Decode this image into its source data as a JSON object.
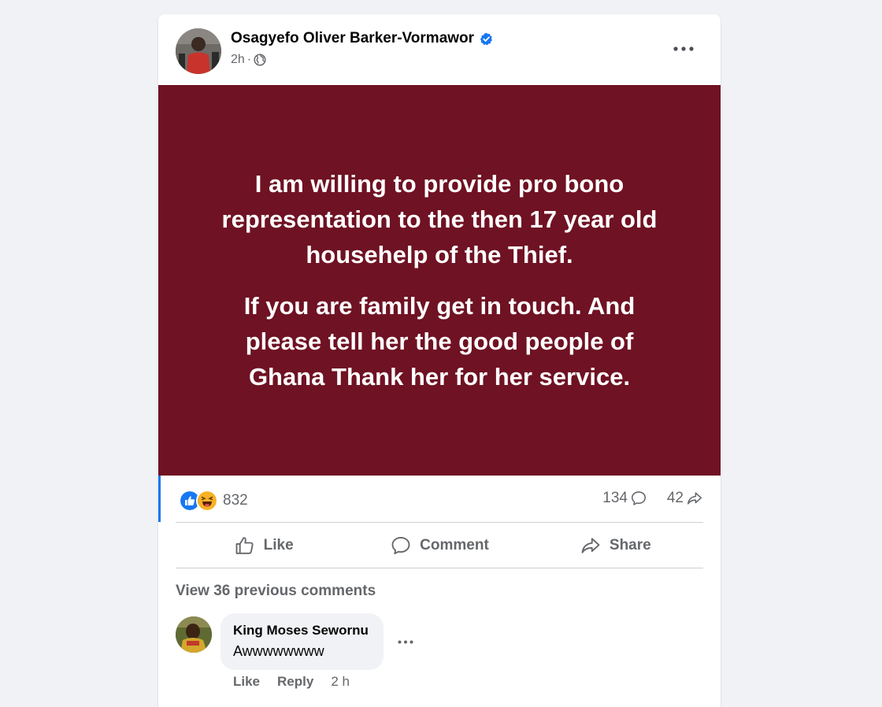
{
  "post": {
    "author": "Osagyefo Oliver Barker-Vormawor",
    "time": "2h",
    "meta_separator": "·",
    "background_color": "#6f1223",
    "paragraphs": [
      "I am willing to provide pro bono\nrepresentation to the then 17 year old\nhousehelp of the Thief.",
      "If you are family get in touch. And\nplease tell her the good people of\nGhana Thank her for her service."
    ]
  },
  "stats": {
    "reactions_count": "832",
    "comments_count": "134",
    "shares_count": "42",
    "reaction_icons": [
      "like-icon",
      "haha-icon"
    ]
  },
  "actions": {
    "like": "Like",
    "comment": "Comment",
    "share": "Share"
  },
  "comments": {
    "view_previous": "View 36 previous comments",
    "items": [
      {
        "author": "King Moses Sewornu",
        "text": "Awwwwwwww",
        "like_label": "Like",
        "reply_label": "Reply",
        "time": "2 h"
      }
    ]
  },
  "colors": {
    "page_bg": "#f0f2f5",
    "accent": "#1877f2",
    "muted_text": "#65676b"
  }
}
